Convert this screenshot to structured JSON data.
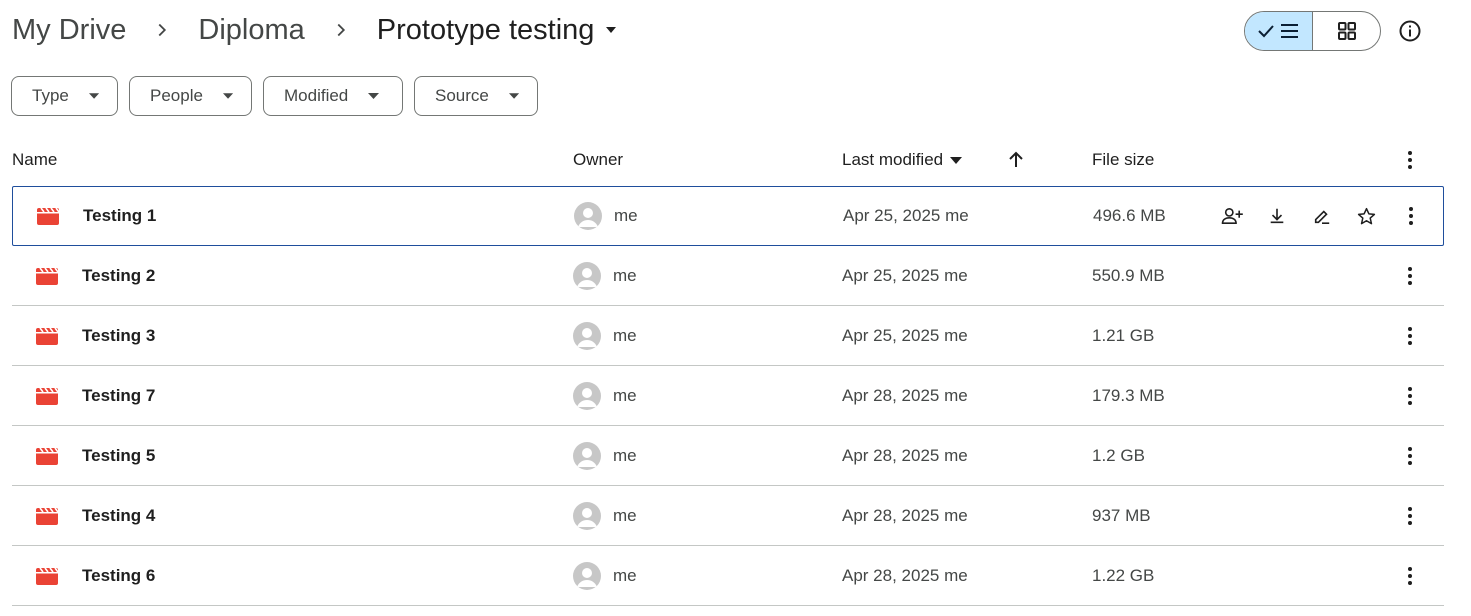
{
  "breadcrumb": {
    "items": [
      "My Drive",
      "Diploma"
    ],
    "current": "Prototype testing"
  },
  "view_toggle": {
    "list_label": "list-view",
    "grid_label": "grid-view",
    "active": "list"
  },
  "filters": [
    {
      "label": "Type"
    },
    {
      "label": "People"
    },
    {
      "label": "Modified"
    },
    {
      "label": "Source"
    }
  ],
  "table": {
    "columns": {
      "name": "Name",
      "owner": "Owner",
      "modified": "Last modified",
      "size": "File size"
    },
    "rows": [
      {
        "name": "Testing 1",
        "owner": "me",
        "modified": "Apr 25, 2025 me",
        "size": "496.6 MB",
        "selected": true
      },
      {
        "name": "Testing 2",
        "owner": "me",
        "modified": "Apr 25, 2025 me",
        "size": "550.9 MB"
      },
      {
        "name": "Testing 3",
        "owner": "me",
        "modified": "Apr 25, 2025 me",
        "size": "1.21 GB"
      },
      {
        "name": "Testing 7",
        "owner": "me",
        "modified": "Apr 28, 2025 me",
        "size": "179.3 MB"
      },
      {
        "name": "Testing 5",
        "owner": "me",
        "modified": "Apr 28, 2025 me",
        "size": "1.2 GB"
      },
      {
        "name": "Testing 4",
        "owner": "me",
        "modified": "Apr 28, 2025 me",
        "size": "937 MB"
      },
      {
        "name": "Testing 6",
        "owner": "me",
        "modified": "Apr 28, 2025 me",
        "size": "1.22 GB"
      }
    ]
  },
  "colors": {
    "video_icon": "#ea4335",
    "toggle_active": "#c2e7ff",
    "selected_border": "#1f4e9c"
  },
  "icons": {
    "row_actions": [
      "share-icon",
      "download-icon",
      "rename-icon",
      "star-icon"
    ],
    "file_type": "video-icon"
  }
}
